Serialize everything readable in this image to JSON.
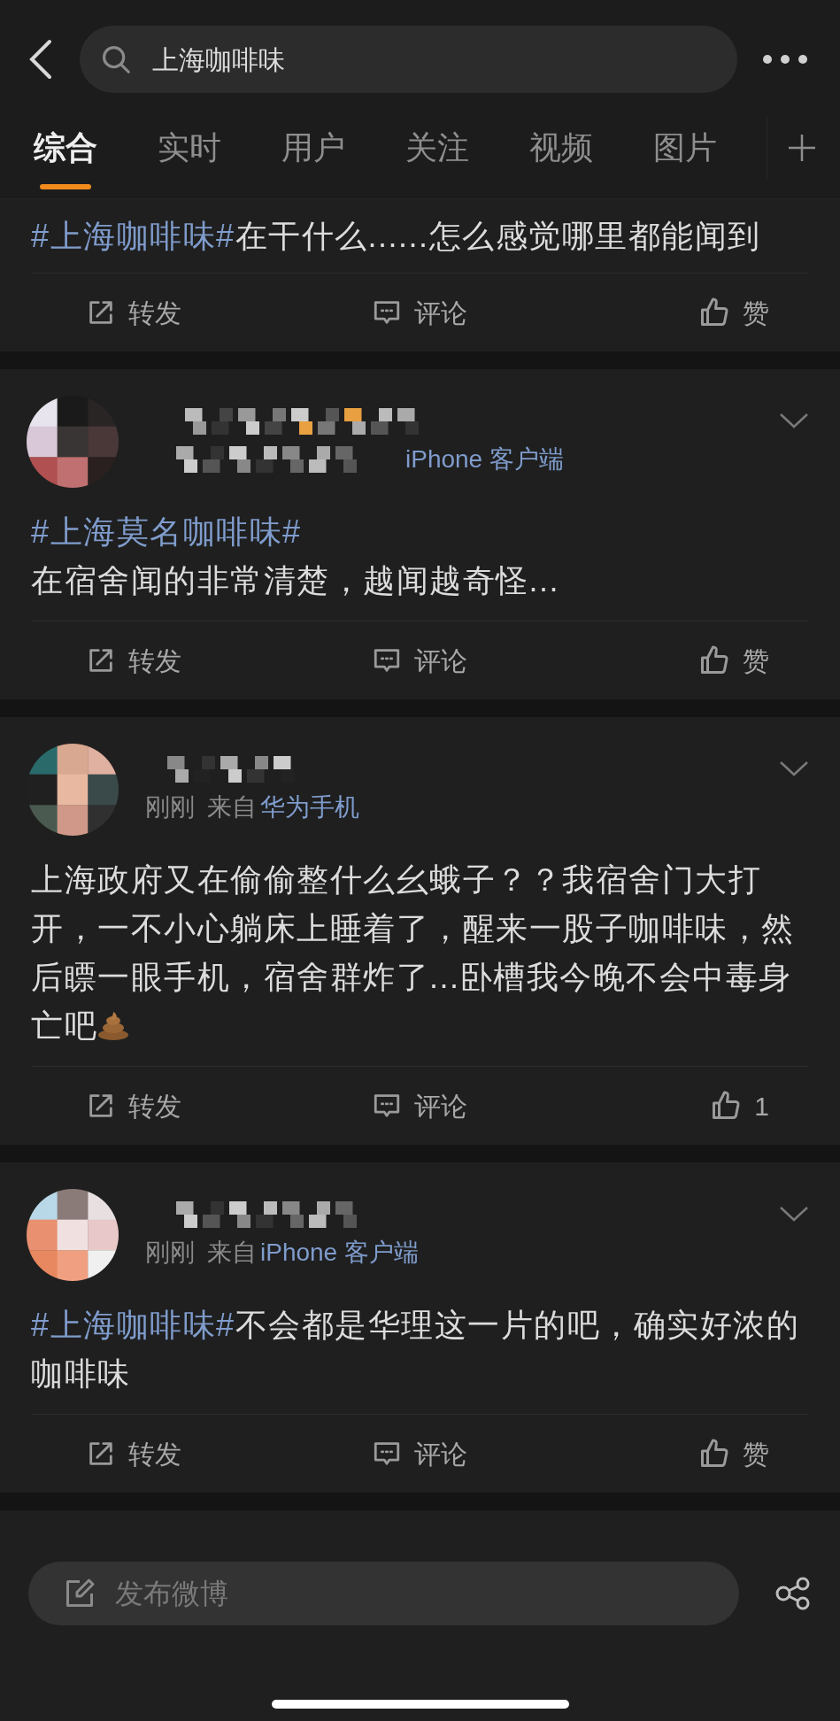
{
  "search": {
    "value": "上海咖啡味"
  },
  "tabs": [
    {
      "label": "综合",
      "selected": true
    },
    {
      "label": "实时",
      "selected": false
    },
    {
      "label": "用户",
      "selected": false
    },
    {
      "label": "关注",
      "selected": false
    },
    {
      "label": "视频",
      "selected": false
    },
    {
      "label": "图片",
      "selected": false
    }
  ],
  "posts": [
    {
      "paragraphs": [
        [
          {
            "kind": "topic",
            "text": "#上海咖啡味#"
          },
          {
            "kind": "plain",
            "text": "在干什么......怎么感觉哪里都能闻到"
          }
        ]
      ],
      "actions": [
        {
          "kind": "repost",
          "label": "转发"
        },
        {
          "kind": "comment",
          "label": "评论"
        },
        {
          "kind": "like",
          "label": "赞"
        }
      ]
    },
    {
      "meta": {
        "source": "iPhone 客户端"
      },
      "paragraphs": [
        [
          {
            "kind": "topic",
            "text": "#上海莫名咖啡味#"
          }
        ],
        [
          {
            "kind": "plain",
            "text": "在宿舍闻的非常清楚，越闻越奇怪..."
          }
        ]
      ],
      "actions": [
        {
          "kind": "repost",
          "label": "转发"
        },
        {
          "kind": "comment",
          "label": "评论"
        },
        {
          "kind": "like",
          "label": "赞"
        }
      ]
    },
    {
      "meta": {
        "time": "刚刚",
        "via": "来自",
        "source": "华为手机"
      },
      "paragraphs": [
        [
          {
            "kind": "plain",
            "text": "上海政府又在偷偷整什么幺蛾子？？我宿舍门大打开，一不小心躺床上睡着了，醒来一股子咖啡味，然后瞟一眼手机，宿舍群炸了...卧槽我今晚不会中毒身亡吧"
          },
          {
            "kind": "emoji"
          }
        ]
      ],
      "actions": [
        {
          "kind": "repost",
          "label": "转发"
        },
        {
          "kind": "comment",
          "label": "评论"
        },
        {
          "kind": "like",
          "label": "1"
        }
      ]
    },
    {
      "meta": {
        "time": "刚刚",
        "via": "来自",
        "source": "iPhone 客户端"
      },
      "paragraphs": [
        [
          {
            "kind": "topic",
            "text": "#上海咖啡味#"
          },
          {
            "kind": "plain",
            "text": "不会都是华理这一片的吧，确实好浓的咖啡味"
          }
        ]
      ],
      "actions": [
        {
          "kind": "repost",
          "label": "转发"
        },
        {
          "kind": "comment",
          "label": "评论"
        },
        {
          "kind": "like",
          "label": "赞"
        }
      ]
    }
  ],
  "composer": {
    "placeholder": "发布微博"
  }
}
